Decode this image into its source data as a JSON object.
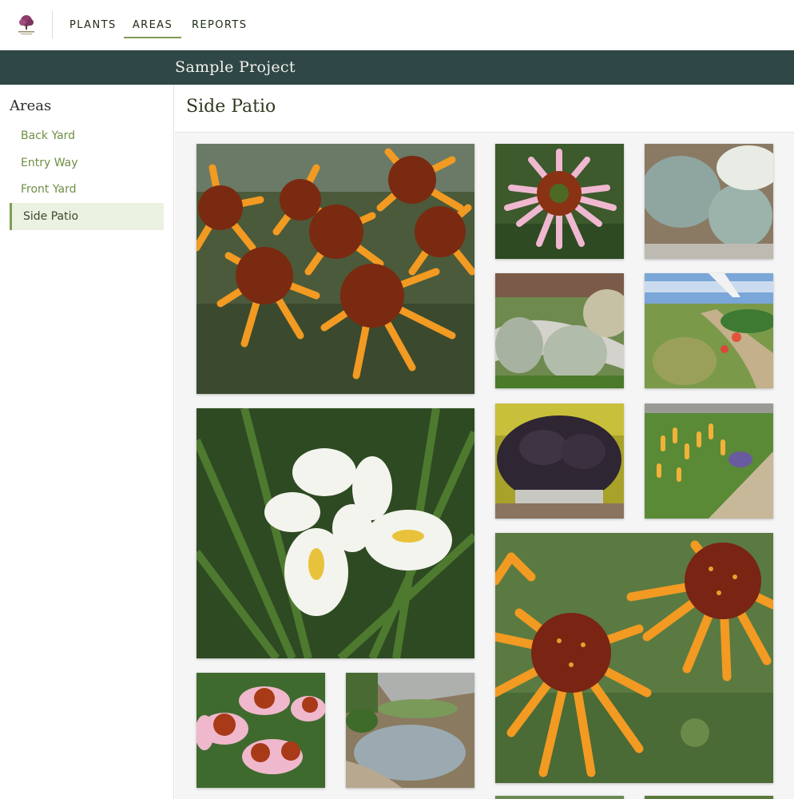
{
  "nav": {
    "logo_icon": "grand-tree-logo-icon",
    "items": [
      {
        "label": "PLANTS"
      },
      {
        "label": "AREAS",
        "active": true
      },
      {
        "label": "REPORTS"
      }
    ]
  },
  "project": {
    "title": "Sample Project"
  },
  "sidebar": {
    "heading": "Areas",
    "items": [
      {
        "label": "Back Yard"
      },
      {
        "label": "Entry Way"
      },
      {
        "label": "Front Yard"
      },
      {
        "label": "Side Patio",
        "active": true
      }
    ]
  },
  "area": {
    "title": "Side Patio"
  },
  "gallery": {
    "photos": [
      {
        "subject": "orange-coneflowers-photo"
      },
      {
        "subject": "pink-coneflower-photo"
      },
      {
        "subject": "blue-fescue-grass-photo"
      },
      {
        "subject": "ornamental-grasses-border-photo"
      },
      {
        "subject": "garden-path-sculpture-photo"
      },
      {
        "subject": "white-iris-photo"
      },
      {
        "subject": "dark-heuchera-pot-photo"
      },
      {
        "subject": "red-hot-poker-border-photo"
      },
      {
        "subject": "orange-coneflower-closeup-photo"
      },
      {
        "subject": "pink-coneflowers-cluster-photo"
      },
      {
        "subject": "rock-garden-grasses-photo"
      }
    ]
  },
  "colors": {
    "accent_green": "#7d9f55",
    "project_bar": "#2f4746",
    "sidebar_active_bg": "#ebf2e1"
  }
}
